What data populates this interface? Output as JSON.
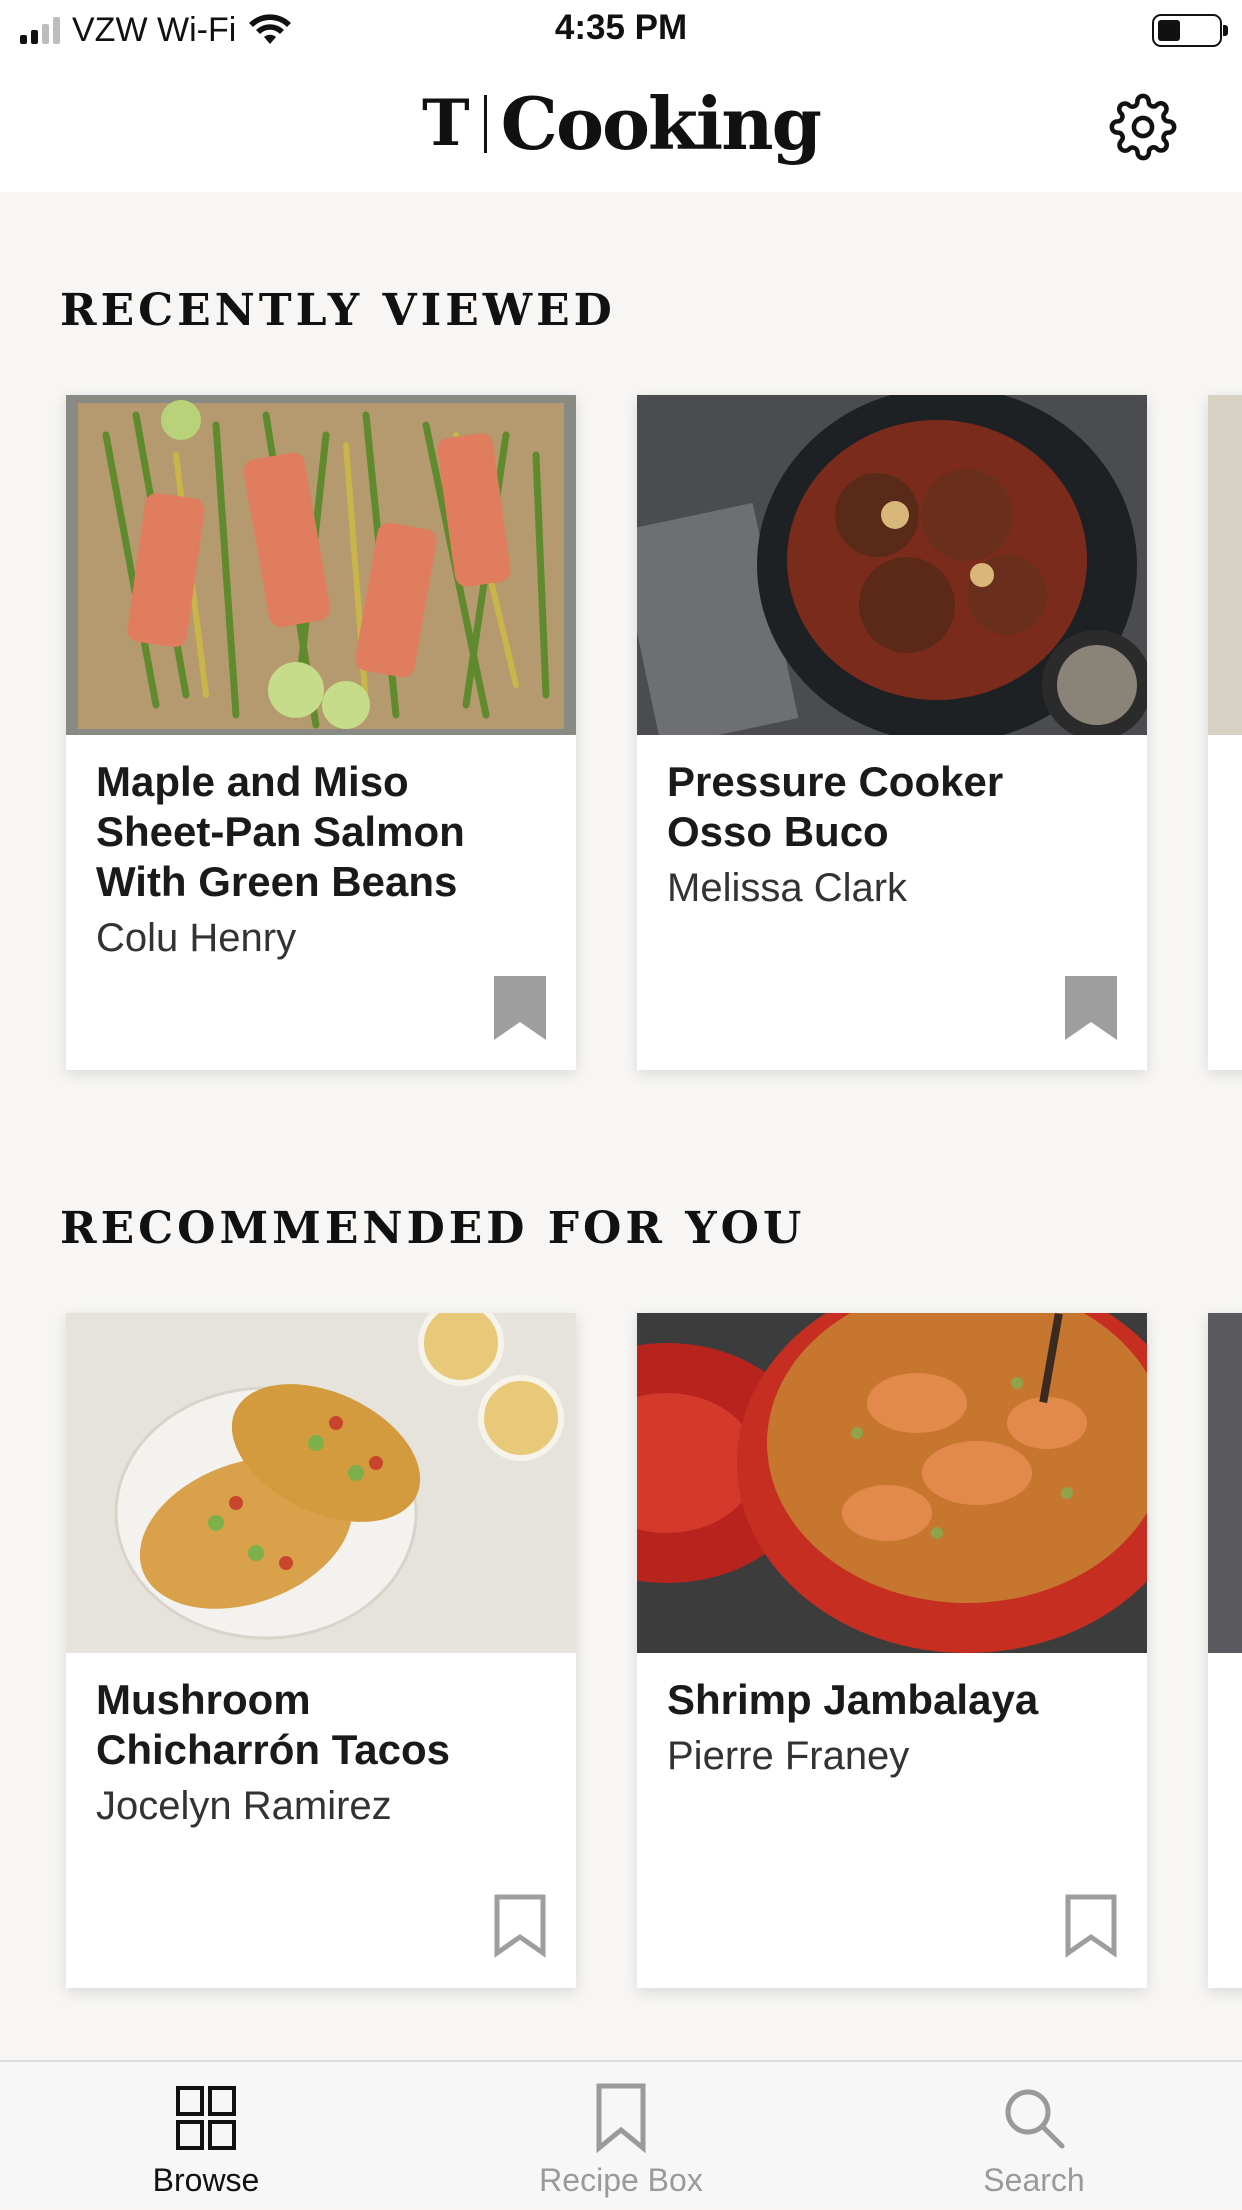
{
  "status_bar": {
    "carrier": "VZW Wi-Fi",
    "time": "4:35 PM"
  },
  "header": {
    "logo_mark": "T",
    "logo_text": "Cooking",
    "settings_icon": "gear-icon"
  },
  "recently_viewed": {
    "title": "RECENTLY VIEWED",
    "cards": [
      {
        "title": "Maple and Miso Sheet-Pan Salmon With Green Beans",
        "author": "Colu Henry",
        "saved": true
      },
      {
        "title": "Pressure Cooker Osso Buco",
        "author": "Melissa Clark",
        "saved": true
      }
    ]
  },
  "recommended": {
    "title": "RECOMMENDED FOR YOU",
    "cards": [
      {
        "title": "Mushroom Chicharrón Tacos",
        "author": "Jocelyn Ramirez",
        "saved": false
      },
      {
        "title": "Shrimp Jambalaya",
        "author": "Pierre Franey",
        "saved": false
      }
    ]
  },
  "tabbar": {
    "tabs": [
      {
        "label": "Browse",
        "icon": "grid-icon",
        "active": true
      },
      {
        "label": "Recipe Box",
        "icon": "bookmark-icon",
        "active": false
      },
      {
        "label": "Search",
        "icon": "search-icon",
        "active": false
      }
    ]
  },
  "colors": {
    "background": "#f7f6f4",
    "card": "#ffffff",
    "bookmark_filled": "#9e9e9e",
    "tab_inactive": "#9a9a9a"
  }
}
